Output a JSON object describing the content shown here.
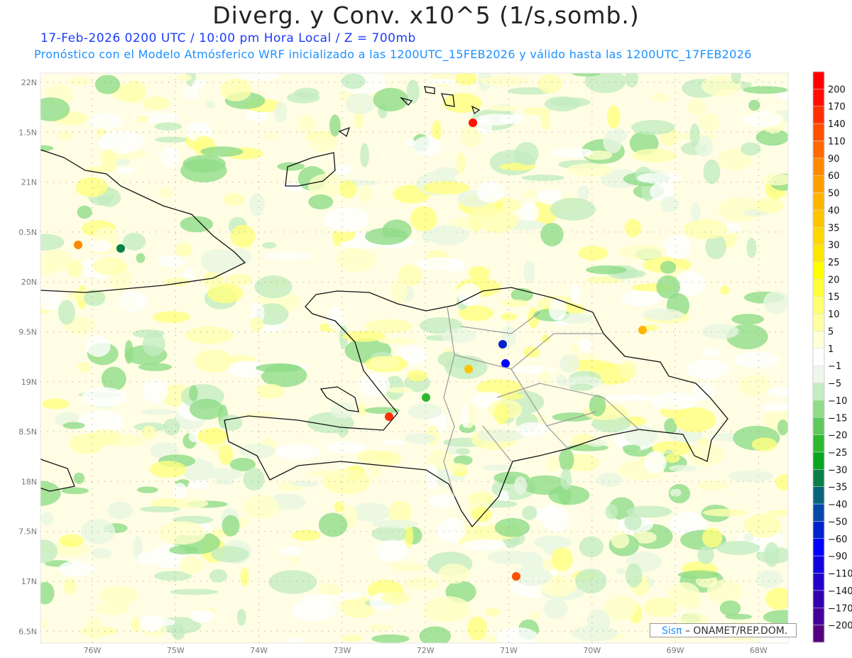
{
  "title": "Diverg. y Conv. x10^5 (1/s,somb.)",
  "subtitle_time": "17-Feb-2026  0200 UTC / 10:00 pm Hora Local / Z = 700mb",
  "subtitle_model": "Pronóstico con el Modelo Atmósferico WRF inicializado a las 1200UTC_15FEB2026 y válido hasta las  1200UTC_17FEB2026",
  "lat_labels": [
    "22N",
    "1.5N",
    "21N",
    "0.5N",
    "20N",
    "9.5N",
    "19N",
    "8.5N",
    "18N",
    "7.5N",
    "17N",
    "6.5N"
  ],
  "lon_labels": [
    "76W",
    "75W",
    "74W",
    "73W",
    "72W",
    "71W",
    "70W",
    "69W",
    "68W"
  ],
  "colorbar": {
    "labels": [
      "200",
      "170",
      "140",
      "110",
      "90",
      "60",
      "50",
      "40",
      "35",
      "30",
      "25",
      "20",
      "15",
      "10",
      "5",
      "1",
      "-1",
      "-5",
      "-10",
      "-15",
      "-20",
      "-25",
      "-30",
      "-35",
      "-40",
      "-50",
      "-60",
      "-90",
      "-110",
      "-140",
      "-170",
      "-200"
    ],
    "colors": [
      "#ff0000",
      "#ff1000",
      "#ff3000",
      "#ff5000",
      "#ff6a00",
      "#ff8800",
      "#ffa000",
      "#ffb400",
      "#ffc400",
      "#ffd700",
      "#ffe600",
      "#ffff00",
      "#ffff3a",
      "#ffff70",
      "#ffffa0",
      "#ffffd8",
      "#ffffff",
      "#eef8ea",
      "#c3ecc0",
      "#90dc88",
      "#5ec85c",
      "#2db82d",
      "#08a520",
      "#0a8048",
      "#08647a",
      "#0448a8",
      "#0022cc",
      "#0000ff",
      "#1000e0",
      "#2200c8",
      "#3300b0",
      "#440098",
      "#550080"
    ]
  },
  "credit": {
    "brand": "Sisπ",
    "text": " – ONAMET/REP.DOM."
  }
}
